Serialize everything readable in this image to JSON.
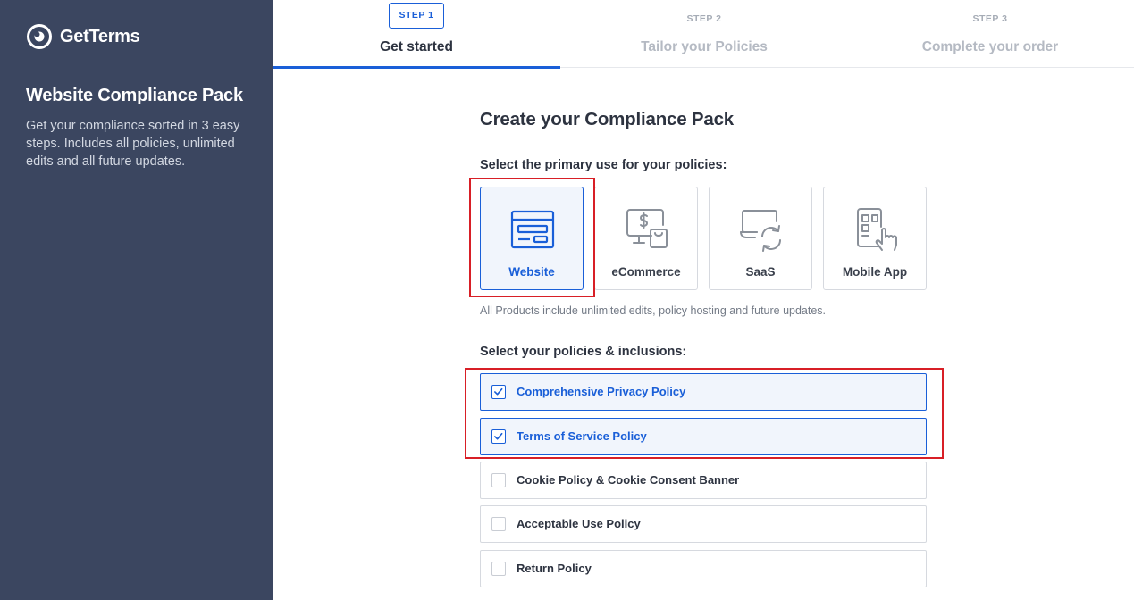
{
  "brand": {
    "name": "GetTerms"
  },
  "sidebar": {
    "title": "Website Compliance Pack",
    "description": "Get your compliance sorted in 3 easy steps. Includes all policies, unlimited edits and all future updates."
  },
  "steps": [
    {
      "number": "STEP 1",
      "label": "Get started",
      "active": true
    },
    {
      "number": "STEP 2",
      "label": "Tailor your Policies",
      "active": false
    },
    {
      "number": "STEP 3",
      "label": "Complete your order",
      "active": false
    }
  ],
  "main": {
    "title": "Create your Compliance Pack",
    "primary_use_label": "Select the primary use for your policies:",
    "primary_use_options": [
      {
        "label": "Website",
        "icon": "website-icon",
        "selected": true
      },
      {
        "label": "eCommerce",
        "icon": "ecommerce-icon",
        "selected": false
      },
      {
        "label": "SaaS",
        "icon": "saas-icon",
        "selected": false
      },
      {
        "label": "Mobile App",
        "icon": "mobile-app-icon",
        "selected": false
      }
    ],
    "products_note": "All Products include unlimited edits, policy hosting and future updates.",
    "policies_label": "Select your policies & inclusions:",
    "policies": [
      {
        "label": "Comprehensive Privacy Policy",
        "checked": true
      },
      {
        "label": "Terms of Service Policy",
        "checked": true
      },
      {
        "label": "Cookie Policy & Cookie Consent Banner",
        "checked": false
      },
      {
        "label": "Acceptable Use Policy",
        "checked": false
      },
      {
        "label": "Return Policy",
        "checked": false
      }
    ]
  },
  "colors": {
    "sidebar_bg": "#3b4660",
    "accent": "#1a5fd8",
    "highlight": "#d81f26"
  }
}
